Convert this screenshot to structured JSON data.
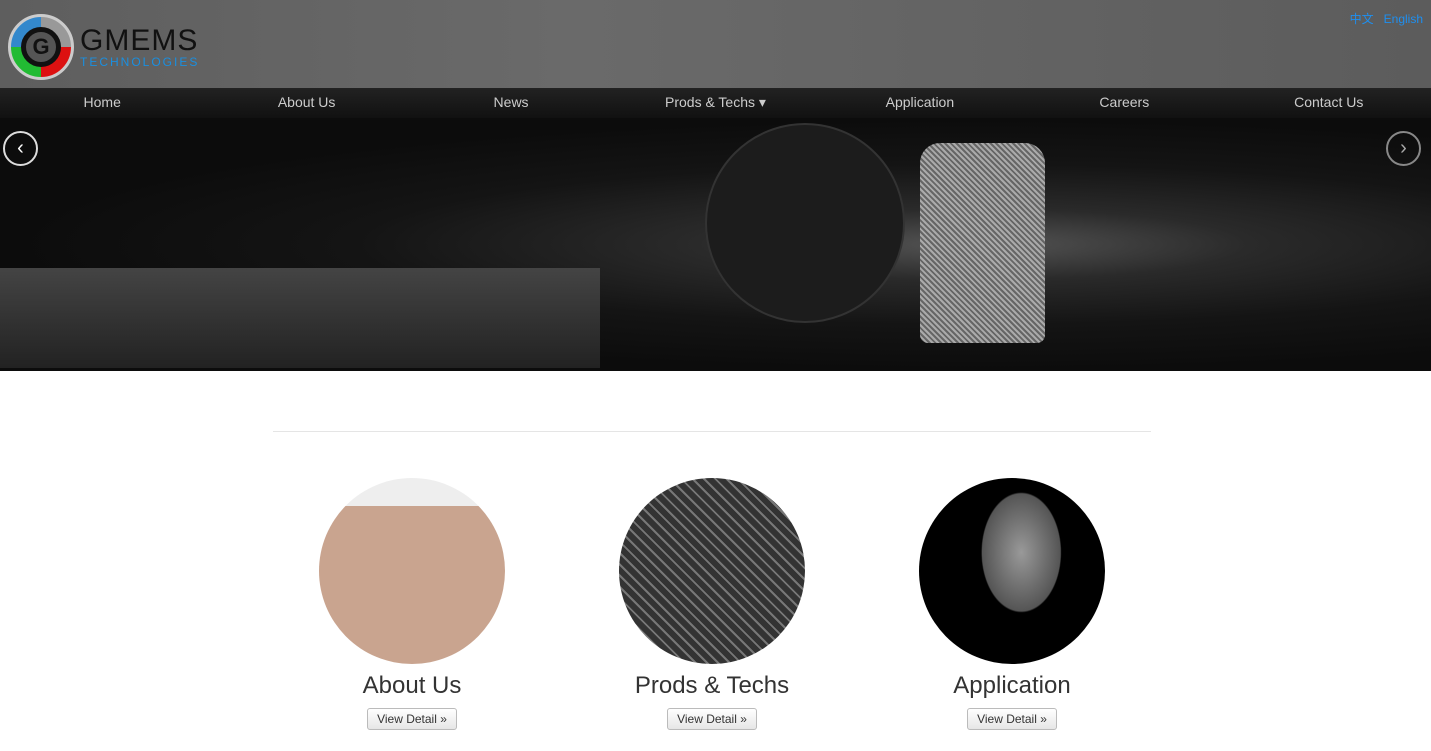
{
  "brand": {
    "name": "GMEMS",
    "sub": "TECHNOLOGIES"
  },
  "lang": [
    "中文",
    "English"
  ],
  "nav": [
    "Home",
    "About Us",
    "News",
    "Prods & Techs ▾",
    "Application",
    "Careers",
    "Contact Us"
  ],
  "carousel": {
    "prev": "‹",
    "next": "›"
  },
  "cards": [
    {
      "title": "About Us",
      "button": "View Detail »"
    },
    {
      "title": "Prods & Techs",
      "button": "View Detail »"
    },
    {
      "title": "Application",
      "button": "View Detail »"
    }
  ]
}
